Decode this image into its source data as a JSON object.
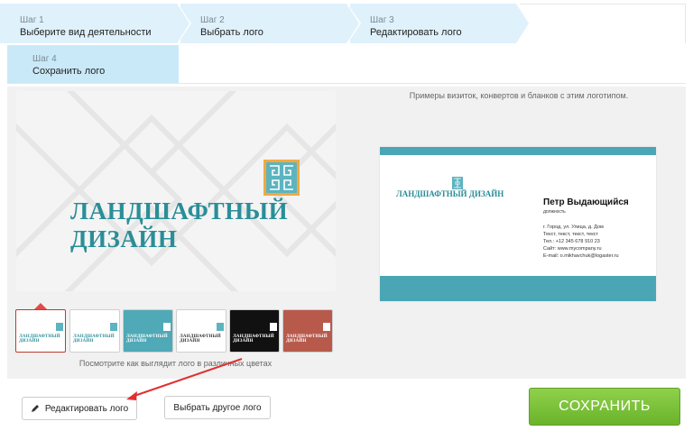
{
  "steps": [
    {
      "num": "Шаг 1",
      "title": "Выберите вид деятельности"
    },
    {
      "num": "Шаг 2",
      "title": "Выбрать лого"
    },
    {
      "num": "Шаг 3",
      "title": "Редактировать лого"
    },
    {
      "num": "Шаг 4",
      "title": "Сохранить лого"
    }
  ],
  "logo": {
    "text": "ЛАНДШАФТНЫЙ ДИЗАЙН",
    "emblem_icon": "spiral-emblem-icon",
    "brand_color": "#2a8e98",
    "emblem_frame_color": "#f3a93e"
  },
  "examples_caption": "Примеры визиток, конвертов и бланков с этим логотипом.",
  "business_card": {
    "name": "Петр Выдающийся",
    "position": "должность",
    "details": [
      "г. Город, ул. Улица, д. Дом",
      "Текст, текст, текст, текст",
      "Тел.: +12 345 678 910 23",
      "Сайт: www.mycompany.ru",
      "E-mail: o.mikhavchuk@logaster.ru"
    ],
    "band_color": "#4aa6b5"
  },
  "variants": [
    {
      "bg": "#ffffff",
      "text_color": "#2a8e98"
    },
    {
      "bg": "#ffffff",
      "text_color": "#2a8e98"
    },
    {
      "bg": "#4fa9b6",
      "text_color": "#ffffff"
    },
    {
      "bg": "#ffffff",
      "text_color": "#333333"
    },
    {
      "bg": "#111111",
      "text_color": "#ffffff"
    },
    {
      "bg": "#b85a4b",
      "text_color": "#ffffff"
    }
  ],
  "colors_caption": "Посмотрите как выглядит лого в различных цветах",
  "buttons": {
    "edit": "Редактировать лого",
    "edit_icon": "pencil-icon",
    "other": "Выбрать другое лого",
    "save": "СОХРАНИТЬ",
    "save_color": "#7cc23a"
  }
}
